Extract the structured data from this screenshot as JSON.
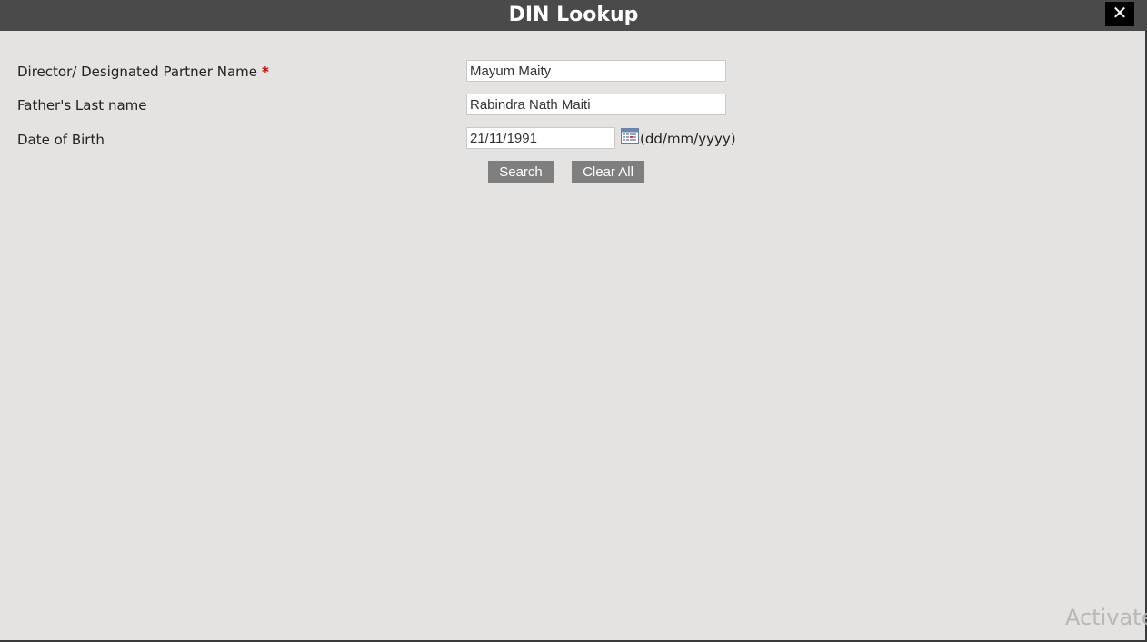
{
  "dialog": {
    "title": "DIN Lookup",
    "close_glyph": "✕"
  },
  "form": {
    "name": {
      "label": "Director/ Designated Partner Name",
      "required_marker": "*",
      "value": "Mayum Maity"
    },
    "father": {
      "label": "Father's Last name",
      "value": "Rabindra Nath Maiti"
    },
    "dob": {
      "label": "Date of Birth",
      "value": "21/11/1991",
      "format_hint": "(dd/mm/yyyy)",
      "icon": "calendar-icon"
    }
  },
  "buttons": {
    "search": "Search",
    "clear_all": "Clear All"
  },
  "watermark": "Activate",
  "colors": {
    "titlebar": "#4a4a4a",
    "background": "#e4e3e1",
    "button": "#7f7f7f",
    "required": "#cc0000",
    "close": "#000000"
  }
}
